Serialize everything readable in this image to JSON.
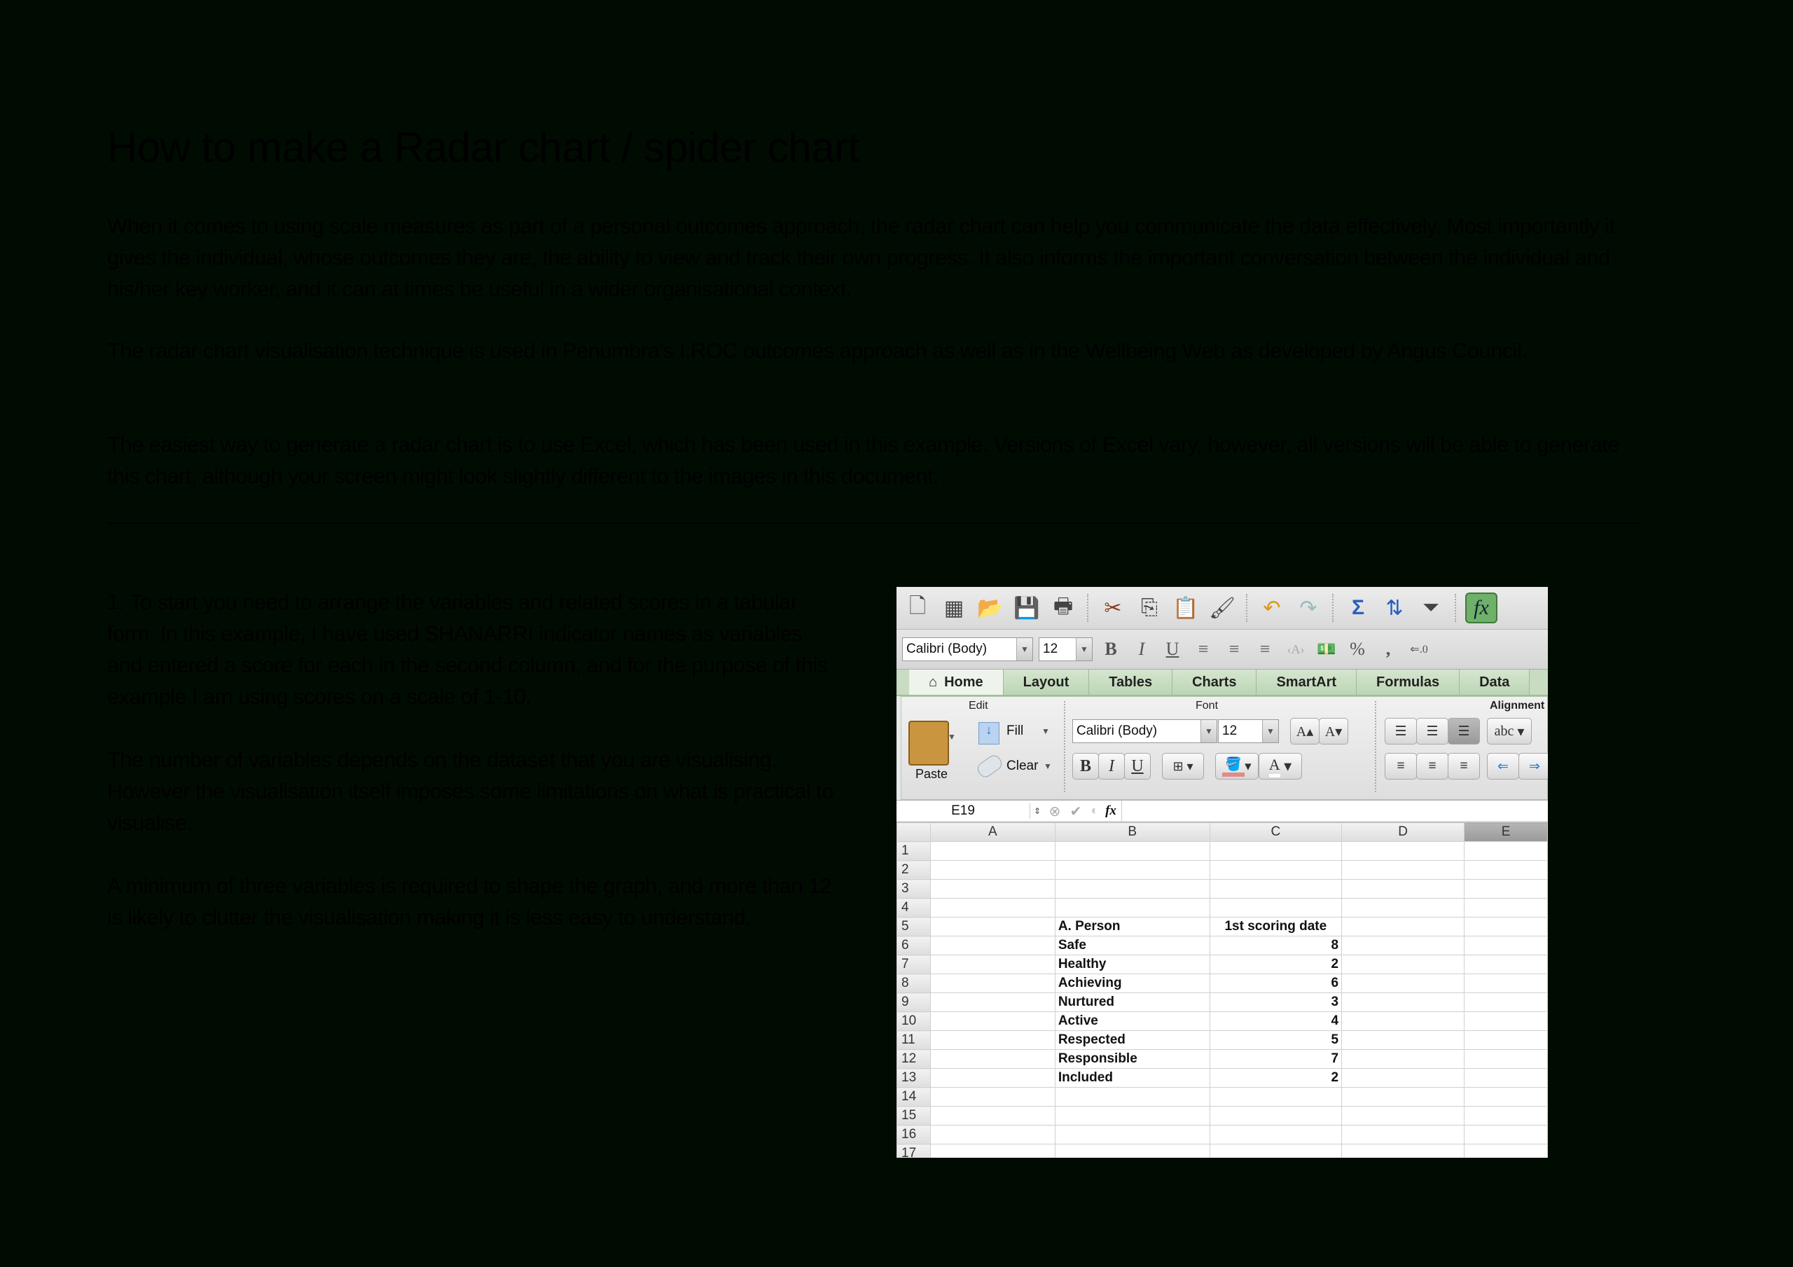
{
  "document": {
    "title": "How to make a Radar chart / spider chart",
    "intro_paragraphs": [
      "When it comes to using scale measures as part of a personal outcomes approach, the radar chart can help you communicate the data effectively. Most importantly it gives the individual, whose outcomes they are, the ability to view and track their own progress. It also informs the important conversation between the individual and his/her key worker, and it can at times be useful in a wider organisational context.",
      "The radar chart visualisation technique is used in Penumbra’s I.ROC outcomes approach as well as in the Wellbeing Web as developed by Angus Council.",
      "The easiest way to generate a radar chart is to use Excel, which has been used in this example.  Versions of Excel vary, however, all versions will be able to generate this chart, although your screen might look slightly different to the images in this document."
    ],
    "step_paragraphs": [
      "1. To start you need to arrange the variables and related scores in a tabular form. In this example, I have used SHANARRI indicator names as variables and entered a score for each in the second column, and for the purpose of this example I am using scores on a scale of 1-10.",
      "The number of variables depends on the dataset that you are visualising. However the visualisation itself imposes some limitations on what is practical to visualise.",
      "A minimum of three variables is required to shape the graph, and more than 12 is likely to clutter the visualisation making it is less easy to understand."
    ]
  },
  "excel": {
    "standard_toolbar": [
      {
        "icon": "new-workbook-icon",
        "glyph": "🗋"
      },
      {
        "icon": "gallery-icon",
        "glyph": "▦"
      },
      {
        "icon": "open-icon",
        "glyph": "📂"
      },
      {
        "icon": "save-icon",
        "glyph": "💾"
      },
      {
        "icon": "print-icon",
        "glyph": "🖶"
      },
      {
        "icon": "cut-icon",
        "glyph": "✂"
      },
      {
        "icon": "copy-icon",
        "glyph": "⎘"
      },
      {
        "icon": "paste-icon",
        "glyph": "📋"
      },
      {
        "icon": "format-painter-icon",
        "glyph": "🖌"
      },
      {
        "icon": "undo-icon",
        "glyph": "↶"
      },
      {
        "icon": "redo-icon",
        "glyph": "↷"
      },
      {
        "icon": "autosum-icon",
        "glyph": "Σ"
      },
      {
        "icon": "sort-icon",
        "glyph": "⇅"
      },
      {
        "icon": "filter-icon",
        "glyph": "⏷"
      },
      {
        "icon": "formula-builder-icon",
        "glyph": "fx"
      }
    ],
    "formatting_toolbar": {
      "font_name": "Calibri (Body)",
      "font_size": "12",
      "bold": "B",
      "italic": "I",
      "underline": "U",
      "percent": "%",
      "comma": ","
    },
    "ribbon_tabs": [
      "Home",
      "Layout",
      "Tables",
      "Charts",
      "SmartArt",
      "Formulas",
      "Data"
    ],
    "active_tab": "Home",
    "ribbon": {
      "groups": [
        "Edit",
        "Font",
        "Alignment"
      ],
      "paste_label": "Paste",
      "fill_label": "Fill",
      "clear_label": "Clear",
      "font_name": "Calibri (Body)",
      "font_size": "12",
      "grow_font": "A▴",
      "shrink_font": "A▾",
      "bold": "B",
      "italic": "I",
      "underline": "U",
      "wrap_label": "abc",
      "font_color": "A"
    },
    "formula_bar": {
      "name_box": "E19",
      "fx": "fx",
      "value": ""
    },
    "columns": [
      "A",
      "B",
      "C",
      "D",
      "E"
    ],
    "selected_column": "E",
    "rows": [
      {
        "n": "1",
        "B": "",
        "C": ""
      },
      {
        "n": "2",
        "B": "",
        "C": ""
      },
      {
        "n": "3",
        "B": "",
        "C": ""
      },
      {
        "n": "4",
        "B": "",
        "C": ""
      },
      {
        "n": "5",
        "B": "A. Person",
        "C": "1st scoring date"
      },
      {
        "n": "6",
        "B": "Safe",
        "C": "8"
      },
      {
        "n": "7",
        "B": "Healthy",
        "C": "2"
      },
      {
        "n": "8",
        "B": "Achieving",
        "C": "6"
      },
      {
        "n": "9",
        "B": "Nurtured",
        "C": "3"
      },
      {
        "n": "10",
        "B": "Active",
        "C": "4"
      },
      {
        "n": "11",
        "B": "Respected",
        "C": "5"
      },
      {
        "n": "12",
        "B": "Responsible",
        "C": "7"
      },
      {
        "n": "13",
        "B": "Included",
        "C": "2"
      },
      {
        "n": "14",
        "B": "",
        "C": ""
      },
      {
        "n": "15",
        "B": "",
        "C": ""
      },
      {
        "n": "16",
        "B": "",
        "C": ""
      },
      {
        "n": "17",
        "B": "",
        "C": ""
      }
    ]
  }
}
